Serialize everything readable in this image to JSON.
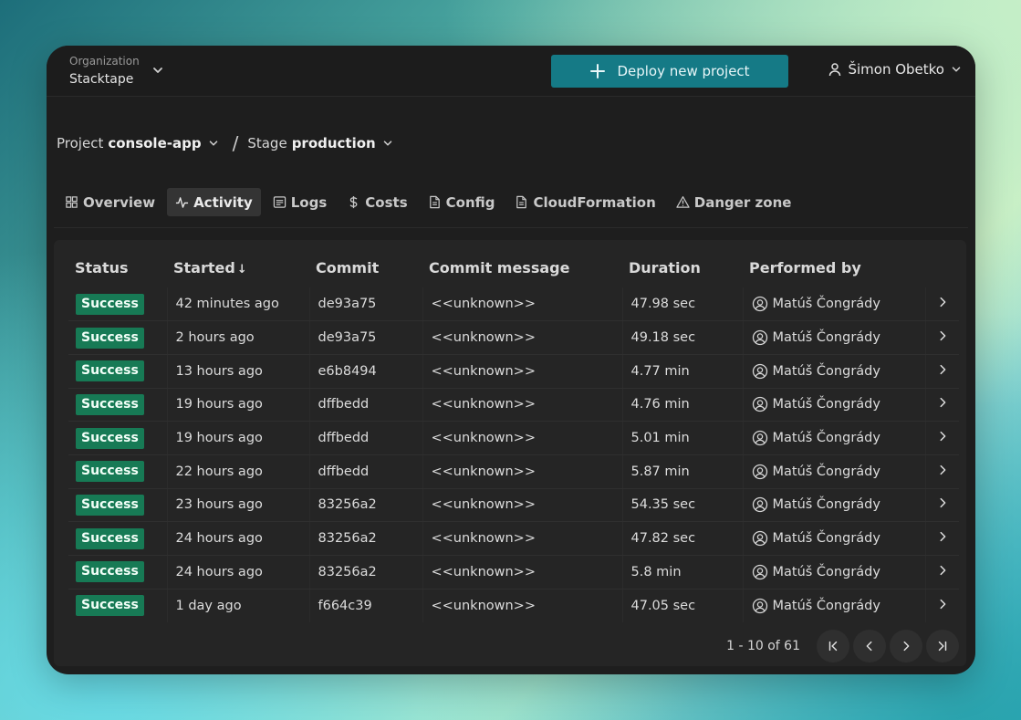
{
  "topbar": {
    "org_label": "Organization",
    "org_name": "Stacktape",
    "deploy_label": "Deploy new project",
    "user_name": "Šimon Obetko"
  },
  "breadcrumb": {
    "project_label": "Project",
    "project_name": "console-app",
    "separator": "/",
    "stage_label": "Stage",
    "stage_name": "production"
  },
  "tabs": [
    {
      "label": "Overview",
      "icon": "grid-icon"
    },
    {
      "label": "Activity",
      "icon": "activity-icon",
      "active": true
    },
    {
      "label": "Logs",
      "icon": "list-icon"
    },
    {
      "label": "Costs",
      "icon": "dollar-icon"
    },
    {
      "label": "Config",
      "icon": "file-icon"
    },
    {
      "label": "CloudFormation",
      "icon": "file-icon"
    },
    {
      "label": "Danger zone",
      "icon": "warning-icon"
    }
  ],
  "table": {
    "headers": {
      "status": "Status",
      "started": "Started",
      "started_sort": "↓",
      "commit": "Commit",
      "message": "Commit message",
      "duration": "Duration",
      "performed_by": "Performed by"
    },
    "rows": [
      {
        "status": "Success",
        "started": "42 minutes ago",
        "commit": "de93a75",
        "message": "<<unknown>>",
        "duration": "47.98 sec",
        "user": "Matúš Čongrády"
      },
      {
        "status": "Success",
        "started": "2 hours ago",
        "commit": "de93a75",
        "message": "<<unknown>>",
        "duration": "49.18 sec",
        "user": "Matúš Čongrády"
      },
      {
        "status": "Success",
        "started": "13 hours ago",
        "commit": "e6b8494",
        "message": "<<unknown>>",
        "duration": "4.77 min",
        "user": "Matúš Čongrády"
      },
      {
        "status": "Success",
        "started": "19 hours ago",
        "commit": "dffbedd",
        "message": "<<unknown>>",
        "duration": "4.76 min",
        "user": "Matúš Čongrády"
      },
      {
        "status": "Success",
        "started": "19 hours ago",
        "commit": "dffbedd",
        "message": "<<unknown>>",
        "duration": "5.01 min",
        "user": "Matúš Čongrády"
      },
      {
        "status": "Success",
        "started": "22 hours ago",
        "commit": "dffbedd",
        "message": "<<unknown>>",
        "duration": "5.87 min",
        "user": "Matúš Čongrády"
      },
      {
        "status": "Success",
        "started": "23 hours ago",
        "commit": "83256a2",
        "message": "<<unknown>>",
        "duration": "54.35 sec",
        "user": "Matúš Čongrády"
      },
      {
        "status": "Success",
        "started": "24 hours ago",
        "commit": "83256a2",
        "message": "<<unknown>>",
        "duration": "47.82 sec",
        "user": "Matúš Čongrády"
      },
      {
        "status": "Success",
        "started": "24 hours ago",
        "commit": "83256a2",
        "message": "<<unknown>>",
        "duration": "5.8 min",
        "user": "Matúš Čongrády"
      },
      {
        "status": "Success",
        "started": "1 day ago",
        "commit": "f664c39",
        "message": "<<unknown>>",
        "duration": "47.05 sec",
        "user": "Matúš Čongrády"
      }
    ]
  },
  "pager": {
    "info": "1 - 10 of 61"
  },
  "colors": {
    "accent": "#157a86",
    "success": "#177a55",
    "window_bg": "#1e1e1e"
  }
}
